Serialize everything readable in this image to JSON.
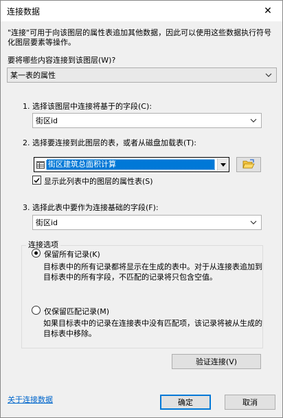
{
  "window": {
    "title": "连接数据",
    "close_glyph": "✕"
  },
  "description": "\"连接\"可用于向该图层的属性表追加其他数据，因此可以使用这些数据执行符号化图层要素等操作。",
  "join_what": {
    "label": "要将哪些内容连接到该图层(W)?",
    "selected": "某一表的属性"
  },
  "step1": {
    "label": "1. 选择该图层中连接将基于的字段(C):",
    "value": "街区id"
  },
  "step2": {
    "label": "2. 选择要连接到此图层的表，或者从磁盘加载表(T):",
    "table_value": "街区建筑总面积计算",
    "show_layer_attrs_label": "显示此列表中的图层的属性表(S)",
    "show_layer_attrs_checked": true
  },
  "step3": {
    "label": "3. 选择此表中要作为连接基础的字段(F):",
    "value": "街区id"
  },
  "join_options": {
    "title": "连接选项",
    "keep_all": {
      "label": "保留所有记录(K)",
      "selected": true,
      "desc": "目标表中的所有记录都将显示在生成的表中。对于从连接表追加到目标表中的所有字段，不匹配的记录将只包含空值。"
    },
    "keep_matching": {
      "label": "仅保留匹配记录(M)",
      "selected": false,
      "desc": "如果目标表中的记录在连接表中没有匹配项，该记录将被从生成的目标表中移除。"
    }
  },
  "buttons": {
    "validate": "验证连接(V)",
    "ok": "确定",
    "cancel": "取消"
  },
  "about_link": "关于连接数据",
  "colors": {
    "accent": "#0078d7",
    "link": "#0066cc"
  }
}
